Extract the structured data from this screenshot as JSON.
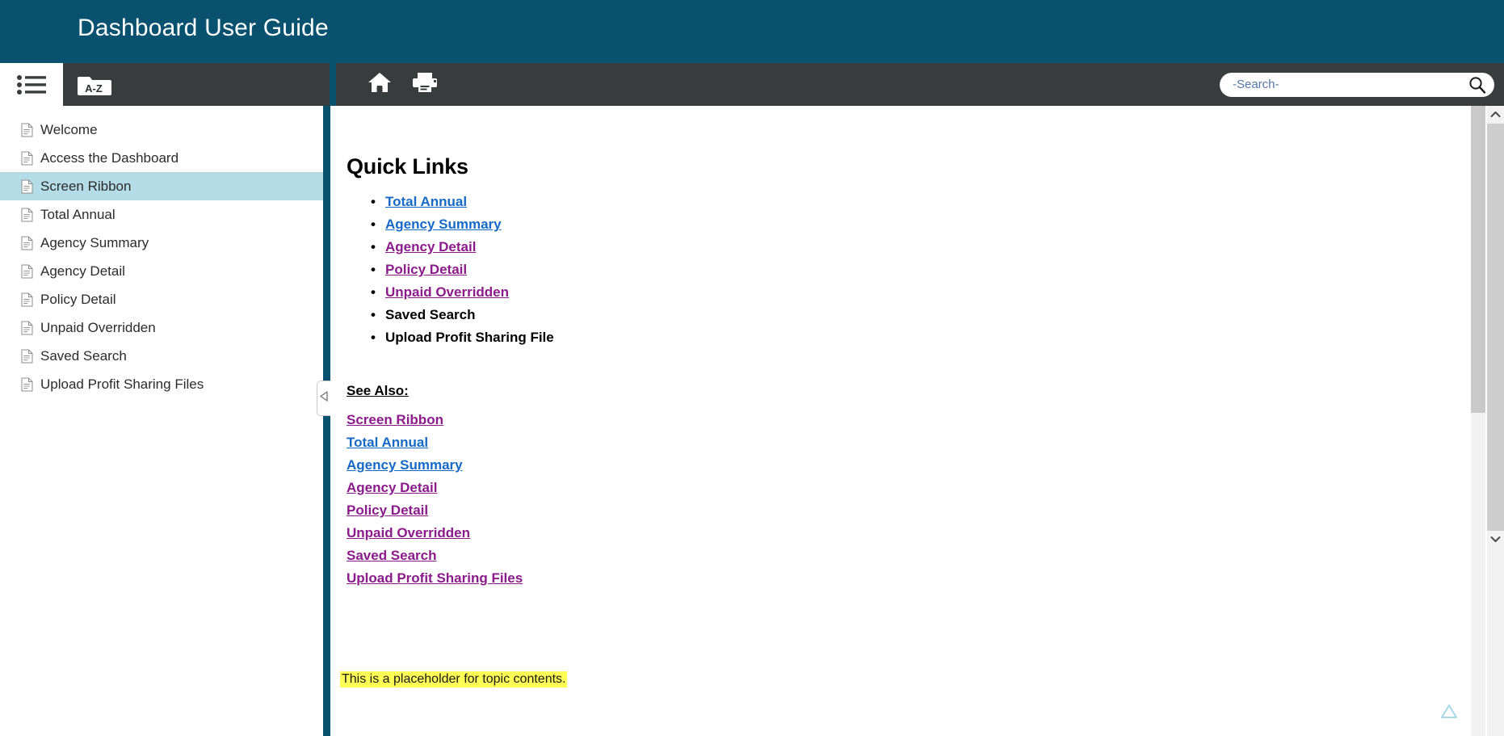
{
  "banner": {
    "title": "Dashboard User Guide",
    "background": "#08516f"
  },
  "nav_tabs": [
    {
      "name": "toc-tab",
      "icon": "list-icon",
      "active": true
    },
    {
      "name": "index-tab",
      "icon": "a-z-folder-icon",
      "label": "A-Z",
      "active": false
    }
  ],
  "topic_toolbar": {
    "home_icon": "home-icon",
    "print_icon": "print-icon"
  },
  "search": {
    "placeholder": "-Search-",
    "value": "",
    "icon": "search-icon"
  },
  "sidebar": {
    "collapse_handle_icon": "triangle-left-icon",
    "items": [
      {
        "label": "Welcome",
        "selected": false
      },
      {
        "label": "Access the Dashboard",
        "selected": false
      },
      {
        "label": "Screen Ribbon",
        "selected": true
      },
      {
        "label": "Total Annual",
        "selected": false
      },
      {
        "label": "Agency Summary",
        "selected": false
      },
      {
        "label": "Agency Detail",
        "selected": false
      },
      {
        "label": "Policy Detail",
        "selected": false
      },
      {
        "label": "Unpaid Overridden",
        "selected": false
      },
      {
        "label": "Saved Search",
        "selected": false
      },
      {
        "label": "Upload Profit Sharing Files",
        "selected": false
      }
    ],
    "selected_highlight": "#b3dce6"
  },
  "topic": {
    "heading": "Quick Links",
    "quick_links": [
      {
        "label": "Total Annual",
        "style": "link-unvisited"
      },
      {
        "label": "Agency Summary",
        "style": "link-unvisited"
      },
      {
        "label": "Agency Detail",
        "style": "link-visited"
      },
      {
        "label": "Policy Detail",
        "style": "link-visited"
      },
      {
        "label": "Unpaid Overridden",
        "style": "link-visited"
      },
      {
        "label": "Saved Search",
        "style": "plain"
      },
      {
        "label": "Upload Profit Sharing File",
        "style": "plain"
      }
    ],
    "see_also_label": "See Also:",
    "see_also": [
      {
        "label": "Screen Ribbon",
        "style": "link-visited"
      },
      {
        "label": "Total Annual",
        "style": "link-unvisited"
      },
      {
        "label": "Agency Summary",
        "style": "link-unvisited"
      },
      {
        "label": "Agency Detail",
        "style": "link-visited"
      },
      {
        "label": "Policy Detail",
        "style": "link-visited"
      },
      {
        "label": "Unpaid Overridden",
        "style": "link-visited"
      },
      {
        "label": "Saved Search",
        "style": "link-visited"
      },
      {
        "label": "Upload Profit Sharing Files",
        "style": "link-visited"
      }
    ],
    "placeholder_text": "This is a placeholder for topic contents.",
    "placeholder_highlight": "#ffff55",
    "back_to_top_icon": "triangle-up-icon"
  },
  "scrollbars": {
    "inner_name": "content-scrollbar",
    "outer_name": "window-scrollbar",
    "up_arrow_icon": "chevron-up-icon",
    "down_arrow_icon": "chevron-down-icon"
  },
  "colors": {
    "teal": "#08516f",
    "toolbar_dark": "#393c3d",
    "link_unvisited": "#1569c7",
    "link_visited": "#8b1a8b"
  }
}
